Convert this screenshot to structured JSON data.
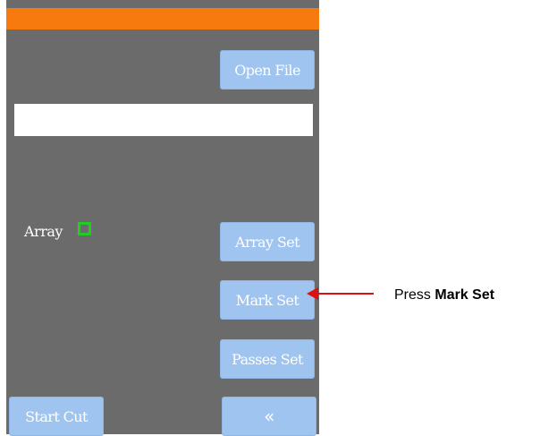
{
  "colors": {
    "panel_bg": "#6b6b6b",
    "header_bar": "#f67a0e",
    "button_bg": "#9fc4ef",
    "button_text": "#ffffff",
    "array_indicator": "#22cc22",
    "callout": "#e01010"
  },
  "buttons": {
    "open_file": "Open File",
    "array_set": "Array Set",
    "mark_set": "Mark Set",
    "passes_set": "Passes Set",
    "start_cut": "Start Cut",
    "back": "«"
  },
  "file_path": {
    "value": ""
  },
  "array": {
    "label": "Array",
    "checked": false
  },
  "callout": {
    "prefix": "Press",
    "target": "Mark Set"
  }
}
